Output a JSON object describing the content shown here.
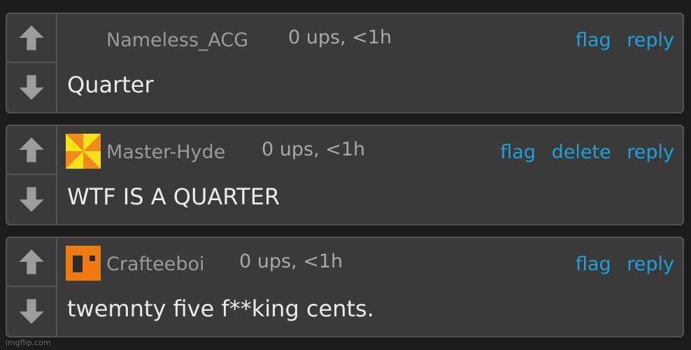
{
  "comments": [
    {
      "username": "Nameless_ACG",
      "meta": "0 ups, <1h",
      "actions": [
        "flag",
        "reply"
      ],
      "text": "Quarter",
      "avatar": "none"
    },
    {
      "username": "Master-Hyde",
      "meta": "0 ups, <1h",
      "actions": [
        "flag",
        "delete",
        "reply"
      ],
      "text": "WTF IS A QUARTER",
      "avatar": "pinwheel-yellow-orange"
    },
    {
      "username": "Crafteeboi",
      "meta": "0 ups, <1h",
      "actions": [
        "flag",
        "reply"
      ],
      "text": "twemnty five f**king cents.",
      "avatar": "orange-block"
    }
  ],
  "watermark": "imgflip.com",
  "colors": {
    "background": "#1b1b1b",
    "card": "#3a3a3a",
    "border": "#555555",
    "link": "#1da1d8",
    "username": "#9a9a9a",
    "body": "#eaeaea"
  },
  "icons": {
    "upvote": "arrow-up-icon",
    "downvote": "arrow-down-icon"
  }
}
